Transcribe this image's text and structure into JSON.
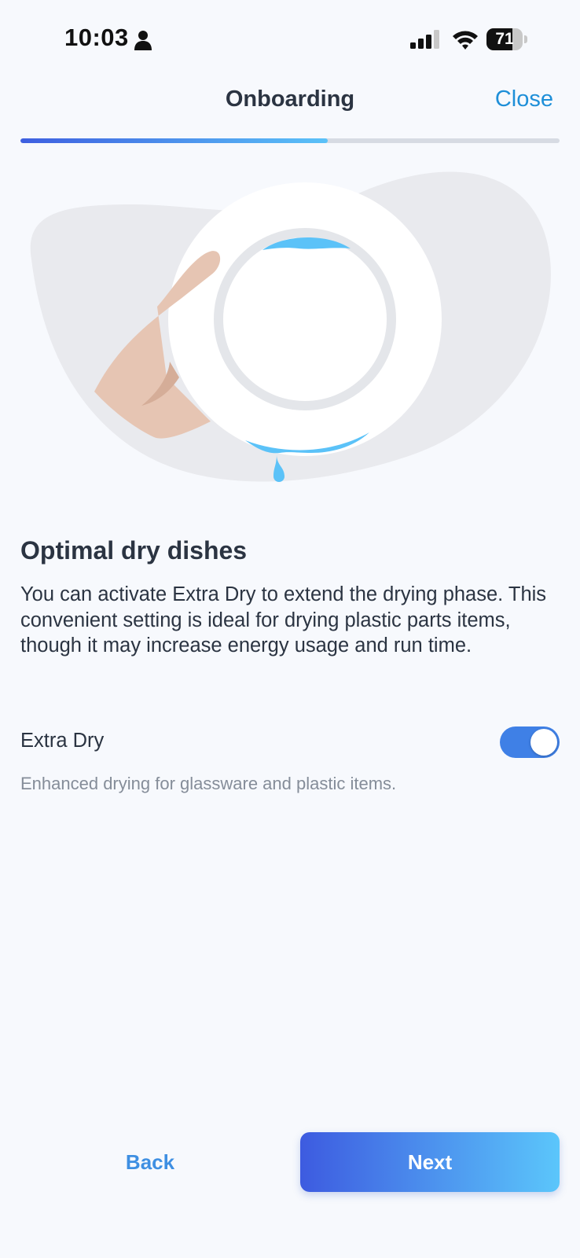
{
  "status_bar": {
    "time": "10:03",
    "battery_level": "71",
    "battery_fraction": 0.71,
    "icons": [
      "person-icon",
      "signal-icon",
      "wifi-icon",
      "battery-icon"
    ]
  },
  "header": {
    "title": "Onboarding",
    "close_label": "Close"
  },
  "progress": {
    "fraction": 0.57
  },
  "illustration": {
    "name": "hand-holding-wet-plate",
    "colors": {
      "background_blob": "#e9eaee",
      "plate": "#ffffff",
      "plate_rim": "#e4e6ea",
      "water": "#5bc2f8",
      "hand": "#e6c5b3",
      "hand_shadow": "#d5ad98"
    }
  },
  "content": {
    "title": "Optimal dry dishes",
    "body": "You can activate Extra Dry to extend the drying phase. This convenient setting is ideal for drying plastic parts items, though it may increase energy usage and run time."
  },
  "extra_dry": {
    "label": "Extra Dry",
    "enabled": true,
    "helper": "Enhanced drying for glassware and plastic items."
  },
  "footer": {
    "back_label": "Back",
    "next_label": "Next"
  },
  "colors": {
    "background": "#f7f9fd",
    "accent": "#1e8fd8",
    "toggle_on": "#3f80e6",
    "gradient_start": "#3d5be0",
    "gradient_end": "#5bc6fb",
    "text_primary": "#2b3442",
    "text_secondary": "#858d99"
  }
}
